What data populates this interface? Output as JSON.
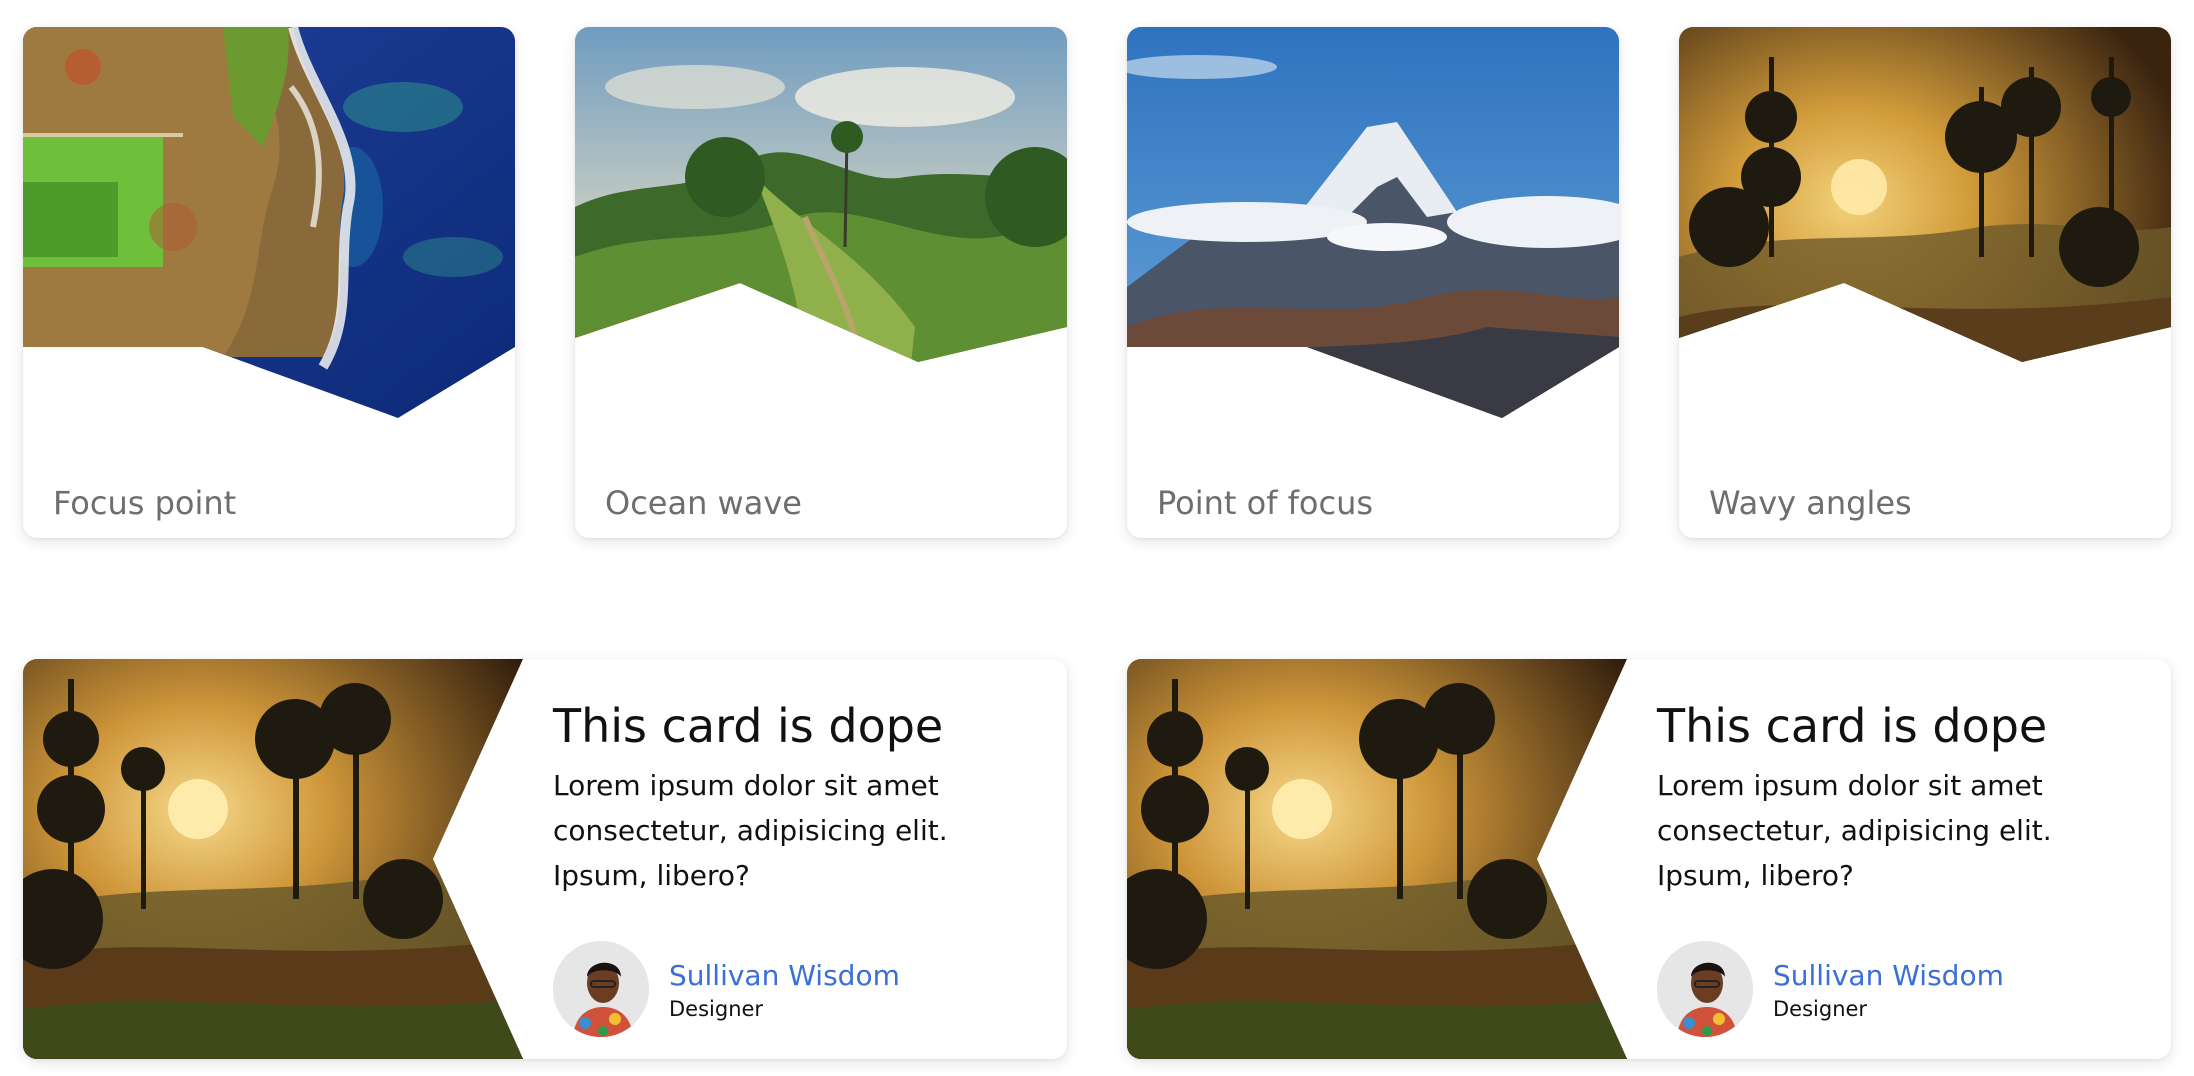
{
  "top_cards": [
    {
      "caption": "Focus point",
      "image": "aerial-coast-photo"
    },
    {
      "caption": "Ocean wave",
      "image": "tropical-hills-photo"
    },
    {
      "caption": "Point of focus",
      "image": "snow-mountain-photo"
    },
    {
      "caption": "Wavy angles",
      "image": "misty-sunset-forest-photo"
    }
  ],
  "feature_cards": [
    {
      "title": "This card is dope",
      "body": "Lorem ipsum dolor sit amet consectetur, adipisicing elit. Ipsum, libero?",
      "author": {
        "name": "Sullivan Wisdom",
        "role": "Designer"
      },
      "image": "misty-sunset-forest-photo"
    },
    {
      "title": "This card is dope",
      "body": "Lorem ipsum dolor sit amet consectetur, adipisicing elit. Ipsum, libero?",
      "author": {
        "name": "Sullivan Wisdom",
        "role": "Designer"
      },
      "image": "misty-sunset-forest-photo"
    }
  ],
  "colors": {
    "caption": "#6e6e6e",
    "author_link": "#3a6fd8",
    "title": "#111111"
  }
}
